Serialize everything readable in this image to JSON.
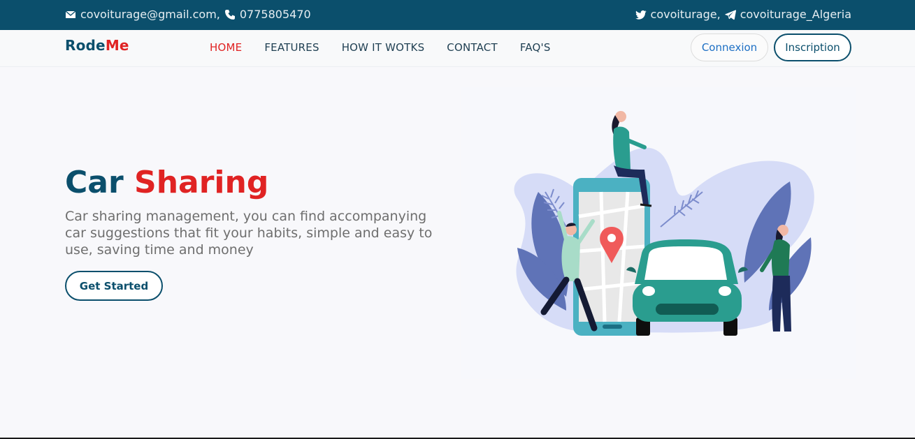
{
  "topbar": {
    "email": "covoiturage@gmail.com,",
    "phone": "0775805470",
    "twitter": "covoiturage,",
    "telegram": "covoiturage_Algeria"
  },
  "brand": {
    "part1": "Rode",
    "part2": "Me"
  },
  "nav": {
    "items": [
      {
        "label": "HOME",
        "active": true
      },
      {
        "label": "FEATURES"
      },
      {
        "label": "HOW IT WOTKS"
      },
      {
        "label": "CONTACT"
      },
      {
        "label": "FAQ'S"
      }
    ]
  },
  "auth": {
    "login": "Connexion",
    "signup": "Inscription"
  },
  "hero": {
    "title_part1": "Car",
    "title_part2": "Sharing",
    "description": "Car sharing management, you can find accompanying car suggestions that fit your habits, simple and easy to use, saving time and money",
    "cta": "Get Started"
  },
  "colors": {
    "primary": "#0b4f6c",
    "accent": "#e02323",
    "link": "#1d6fc4",
    "car": "#1f8f80"
  },
  "icons": {
    "email": "envelope-icon",
    "phone": "phone-icon",
    "twitter": "twitter-icon",
    "telegram": "telegram-icon"
  }
}
